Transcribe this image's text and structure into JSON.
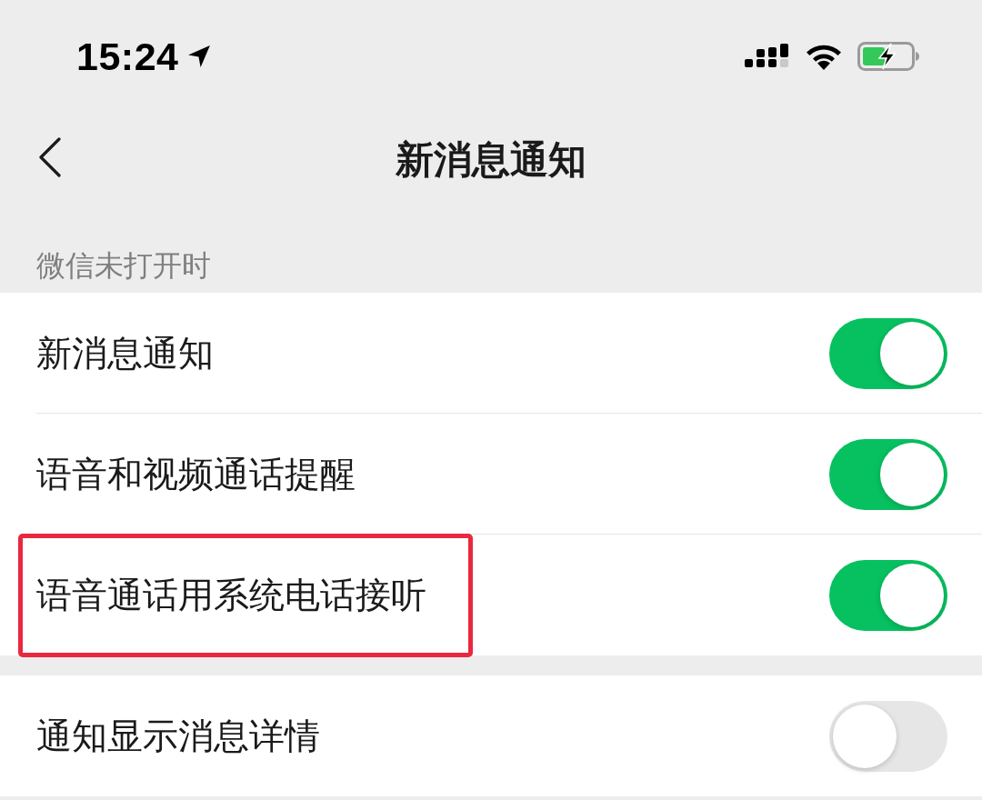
{
  "status_bar": {
    "time": "15:24"
  },
  "nav_bar": {
    "title": "新消息通知"
  },
  "groups": [
    {
      "header": "微信未打开时",
      "rows": [
        {
          "label": "新消息通知",
          "on": true,
          "highlighted": false
        },
        {
          "label": "语音和视频通话提醒",
          "on": true,
          "highlighted": false
        },
        {
          "label": "语音通话用系统电话接听",
          "on": true,
          "highlighted": true
        }
      ]
    },
    {
      "rows": [
        {
          "label": "通知显示消息详情",
          "on": false,
          "highlighted": false
        }
      ]
    }
  ]
}
